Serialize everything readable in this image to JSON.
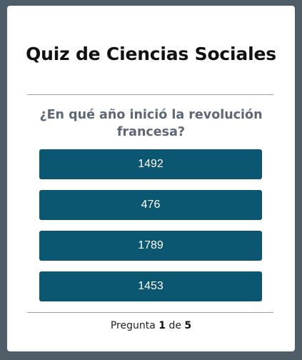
{
  "quiz": {
    "title": "Quiz de Ciencias Sociales",
    "question": "¿En qué año inició la revolución francesa?",
    "answers": [
      "1492",
      "476",
      "1789",
      "1453"
    ],
    "progress": {
      "prefix": "Pregunta",
      "current": "1",
      "separator": "de",
      "total": "5"
    }
  },
  "colors": {
    "background": "#4f5d68",
    "card": "#ffffff",
    "answer_button": "#0b5670",
    "question_text": "#5e6776"
  }
}
